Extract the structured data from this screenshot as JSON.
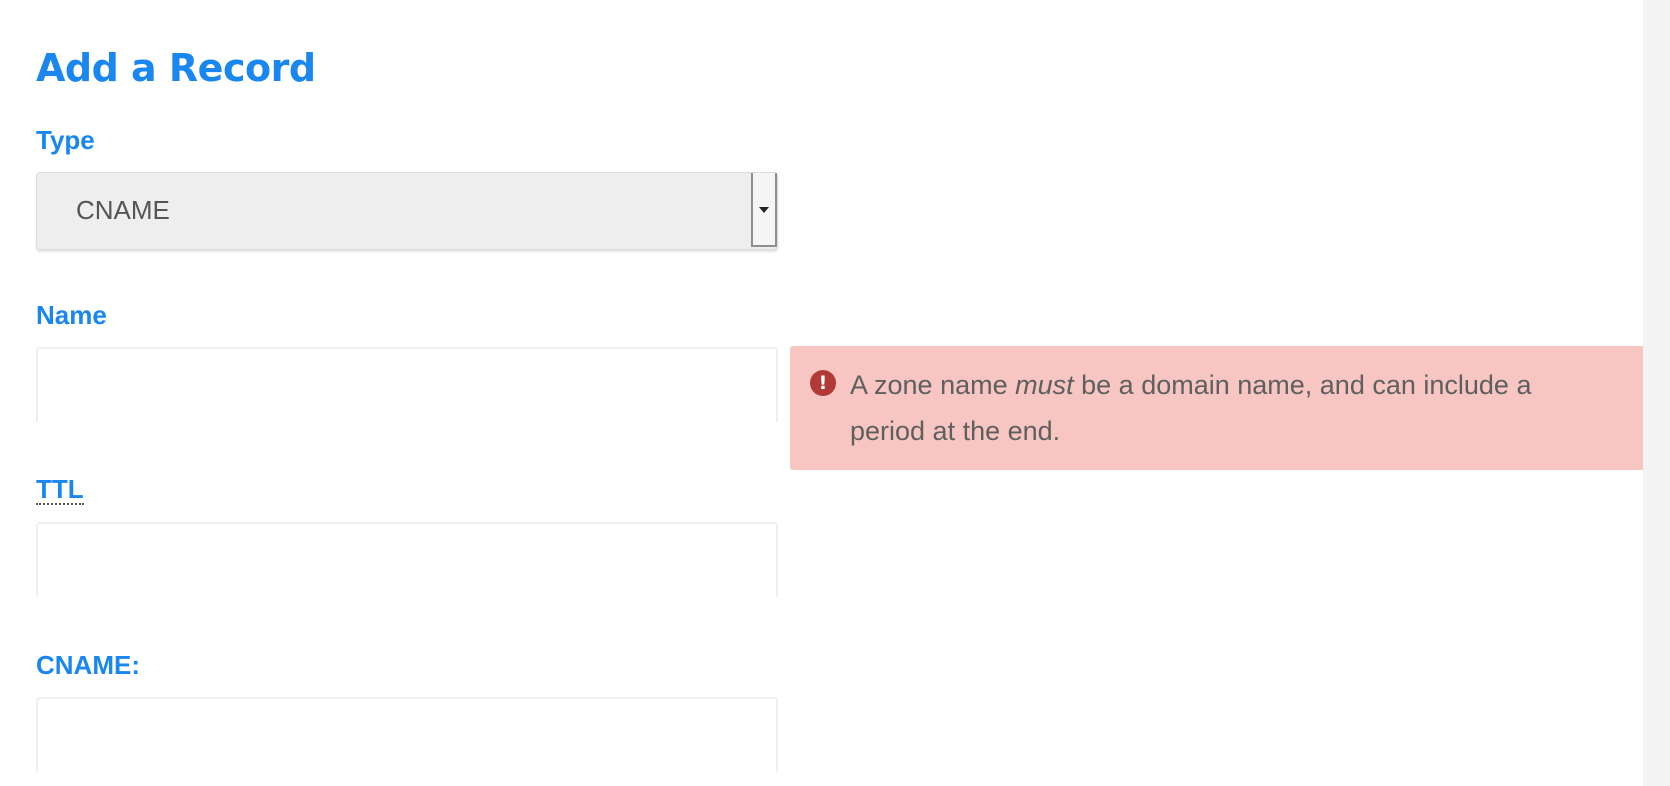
{
  "form": {
    "title": "Add a Record",
    "type": {
      "label": "Type",
      "selected": "CNAME"
    },
    "name": {
      "label": "Name",
      "value": ""
    },
    "ttl": {
      "label": "TTL",
      "value": ""
    },
    "cname": {
      "label": "CNAME:",
      "value": ""
    }
  },
  "error": {
    "icon": "exclamation-circle-icon",
    "icon_glyph": "!",
    "text_before": "A zone name ",
    "text_emphasis": "must",
    "text_after": " be a domain name, and can include a period at the end.",
    "background": "#f7c6c3",
    "icon_color": "#b13a36"
  },
  "colors": {
    "accent": "#1a86f0",
    "select_bg": "#eeeeee"
  }
}
